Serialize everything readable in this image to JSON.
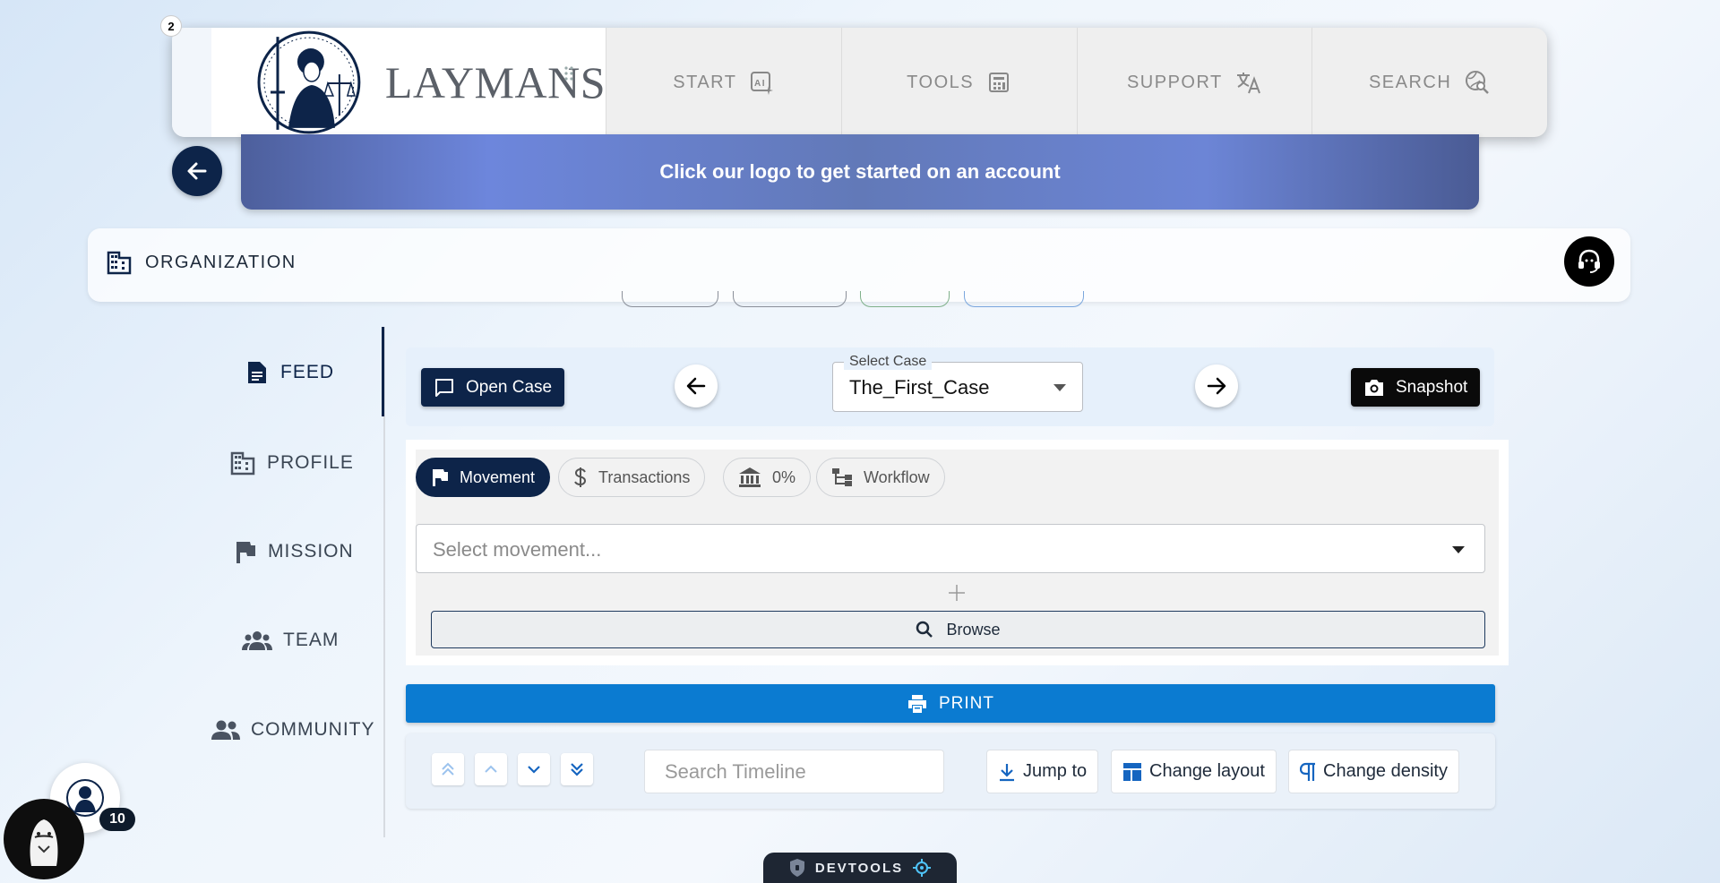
{
  "notification_count": "2",
  "brand": {
    "name": "LAYMANS"
  },
  "nav": {
    "items": [
      {
        "label": "START",
        "icon": "ai-sparkle-icon"
      },
      {
        "label": "TOOLS",
        "icon": "calculator-icon"
      },
      {
        "label": "SUPPORT",
        "icon": "translate-icon"
      },
      {
        "label": "SEARCH",
        "icon": "search-globe-icon"
      }
    ]
  },
  "banner": {
    "text": "Click our logo to get started on an account"
  },
  "org": {
    "title": "ORGANIZATION"
  },
  "sidebar": {
    "items": [
      {
        "label": "FEED",
        "icon": "document-icon",
        "active": true
      },
      {
        "label": "PROFILE",
        "icon": "building-icon"
      },
      {
        "label": "MISSION",
        "icon": "flag-icon"
      },
      {
        "label": "TEAM",
        "icon": "team-icon"
      },
      {
        "label": "COMMUNITY",
        "icon": "community-icon"
      }
    ]
  },
  "case_bar": {
    "open_case_label": "Open Case",
    "select_label": "Select Case",
    "select_value": "The_First_Case",
    "snapshot_label": "Snapshot"
  },
  "tabs": {
    "items": [
      {
        "label": "Movement",
        "active": true
      },
      {
        "label": "Transactions"
      },
      {
        "label": "0%"
      },
      {
        "label": "Workflow"
      }
    ]
  },
  "movement": {
    "placeholder": "Select movement..."
  },
  "browse_label": "Browse",
  "print_label": "PRINT",
  "timeline": {
    "search_placeholder": "Search Timeline",
    "jump_label": "Jump to",
    "layout_label": "Change layout",
    "density_label": "Change density"
  },
  "user": {
    "badge_count": "10"
  },
  "devtools_label": "DEVTOOLS",
  "colors": {
    "navy": "#0d2449",
    "print_blue": "#0b7bd1",
    "banner_blue": "#6d86dc"
  }
}
